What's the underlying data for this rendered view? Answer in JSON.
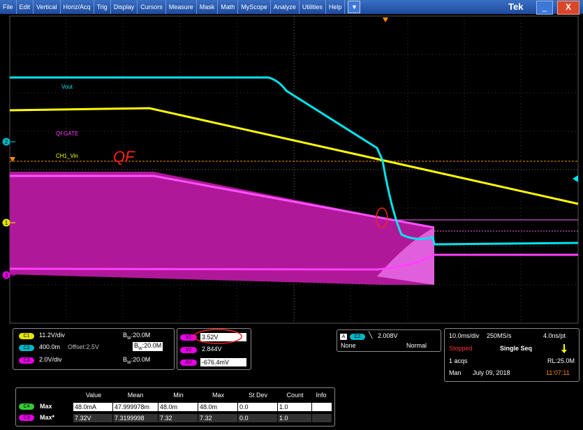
{
  "menubar": {
    "items": [
      "File",
      "Edit",
      "Vertical",
      "Horiz/Acq",
      "Trig",
      "Display",
      "Cursors",
      "Measure",
      "Mask",
      "Math",
      "MyScope",
      "Analyze",
      "Utilities",
      "Help"
    ],
    "dropdown_icon": "▼",
    "brand": "Tek",
    "minimize_icon": "_",
    "close_icon": "X"
  },
  "waveform_labels": {
    "vout": "Vout",
    "qf_gate": "Qf-GATE",
    "ch1_vin": "CH1_Vin"
  },
  "channel_markers": {
    "c2": "2",
    "c1": "1",
    "c3": "3"
  },
  "annotations": {
    "qf_text": "QF"
  },
  "vertical_panel": {
    "c1": {
      "badge": "C1",
      "scale": "11.2V/div",
      "bw_prefix": "B",
      "bw_sub": "W",
      "bw": ":20.0M"
    },
    "c2": {
      "badge": "C2",
      "scale": "400.0m",
      "offset": "Offset:2.5V",
      "bw_prefix": "B",
      "bw_sub": "W",
      "bw": ":20.0M"
    },
    "c3": {
      "badge": "C3",
      "scale": "2.0V/div",
      "bw_prefix": "B",
      "bw_sub": "W",
      "bw": ":20.0M"
    }
  },
  "cursor_panel": {
    "v1": {
      "badge": "V1",
      "value": "3.52V"
    },
    "v2": {
      "badge": "V2",
      "value": "2.844V"
    },
    "dv": {
      "badge": "ΔV",
      "value": "-676.4mV"
    }
  },
  "trigger_panel": {
    "mode_badge": "A",
    "source_badge": "C2",
    "slope_icon": "╲",
    "level": "2.008V",
    "coupling": "None",
    "type": "Normal"
  },
  "acq_panel": {
    "timebase": "10.0ms/div",
    "sample_rate": "250MS/s",
    "resolution": "4.0ns/pt",
    "status": "Stopped",
    "seq": "Single Seq",
    "acqs": "1 acqs",
    "record_length": "RL:25.0M",
    "mode": "Man",
    "date": "July 09, 2018",
    "time": "11:07:11"
  },
  "measurements": {
    "headers": [
      "Value",
      "Mean",
      "Min",
      "Max",
      "St Dev",
      "Count",
      "Info"
    ],
    "rows": [
      {
        "badge": "C4",
        "name": "Max",
        "value": "48.0mA",
        "mean": "47.999978m",
        "min": "48.0m",
        "max": "48.0m",
        "stdev": "0.0",
        "count": "1.0"
      },
      {
        "badge": "C3",
        "name": "Max*",
        "value": "7.32V",
        "mean": "7.3199998",
        "min": "7.32",
        "max": "7.32",
        "stdev": "0.0",
        "count": "1.0"
      }
    ]
  },
  "colors": {
    "ch1": "#ffff00",
    "ch2": "#00e5ee",
    "ch3": "#ff00ff",
    "ch4": "#33cc33",
    "annotation": "#ff2020",
    "trigger_marker": "#ff8c00"
  }
}
